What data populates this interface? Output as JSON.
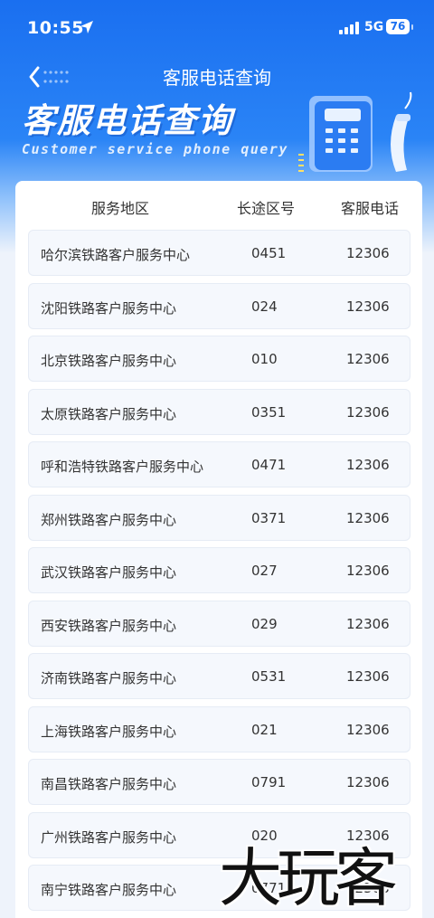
{
  "status_bar": {
    "time": "10:55",
    "network": "5G",
    "battery": "76"
  },
  "nav": {
    "title": "客服电话查询"
  },
  "banner": {
    "title": "客服电话查询",
    "subtitle": "Customer service phone query"
  },
  "table": {
    "headers": {
      "region": "服务地区",
      "area_code": "长途区号",
      "phone": "客服电话"
    },
    "rows": [
      {
        "region": "哈尔滨铁路客户服务中心",
        "area_code": "0451",
        "phone": "12306"
      },
      {
        "region": "沈阳铁路客户服务中心",
        "area_code": "024",
        "phone": "12306"
      },
      {
        "region": "北京铁路客户服务中心",
        "area_code": "010",
        "phone": "12306"
      },
      {
        "region": "太原铁路客户服务中心",
        "area_code": "0351",
        "phone": "12306"
      },
      {
        "region": "呼和浩特铁路客户服务中心",
        "area_code": "0471",
        "phone": "12306"
      },
      {
        "region": "郑州铁路客户服务中心",
        "area_code": "0371",
        "phone": "12306"
      },
      {
        "region": "武汉铁路客户服务中心",
        "area_code": "027",
        "phone": "12306"
      },
      {
        "region": "西安铁路客户服务中心",
        "area_code": "029",
        "phone": "12306"
      },
      {
        "region": "济南铁路客户服务中心",
        "area_code": "0531",
        "phone": "12306"
      },
      {
        "region": "上海铁路客户服务中心",
        "area_code": "021",
        "phone": "12306"
      },
      {
        "region": "南昌铁路客户服务中心",
        "area_code": "0791",
        "phone": "12306"
      },
      {
        "region": "广州铁路客户服务中心",
        "area_code": "020",
        "phone": "12306"
      },
      {
        "region": "南宁铁路客户服务中心",
        "area_code": "0771",
        "phone": "12306"
      }
    ]
  },
  "watermark": "大玩客",
  "colors": {
    "brand_blue": "#1a6ff0",
    "row_bg": "#f5f8fd"
  }
}
